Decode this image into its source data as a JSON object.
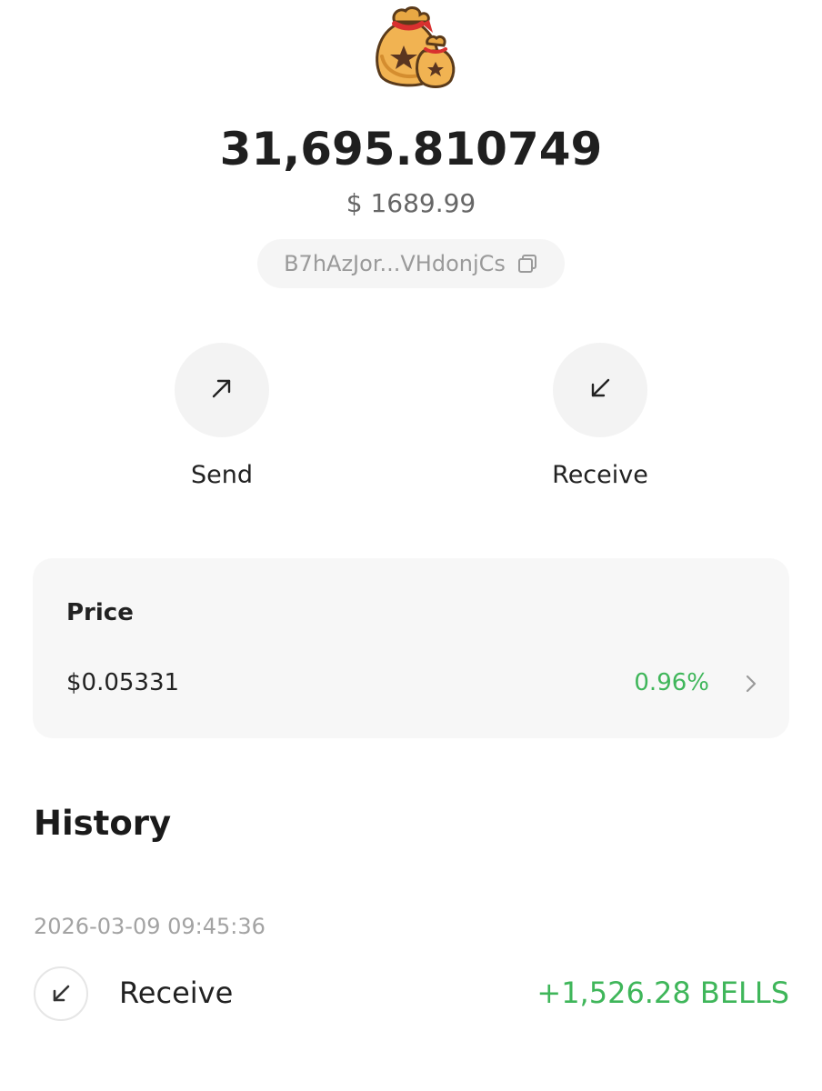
{
  "token": {
    "logo_icon": "money-bag-icon",
    "balance": "31,695.810749",
    "fiat_value": "$ 1689.99",
    "address": "B7hAzJor...VHdonjCs",
    "copy_icon": "copy-icon"
  },
  "actions": [
    {
      "label": "Send",
      "icon": "arrow-up-right-icon"
    },
    {
      "label": "Receive",
      "icon": "arrow-down-left-icon"
    }
  ],
  "price": {
    "title": "Price",
    "value": "$0.05331",
    "change": "0.96%",
    "change_color": "#3fb65a"
  },
  "history": {
    "heading": "History",
    "transactions": [
      {
        "date": "2026-03-09 09:45:36",
        "type": "Receive",
        "amount": "+1,526.28 BELLS",
        "icon": "arrow-down-left-icon"
      }
    ]
  }
}
